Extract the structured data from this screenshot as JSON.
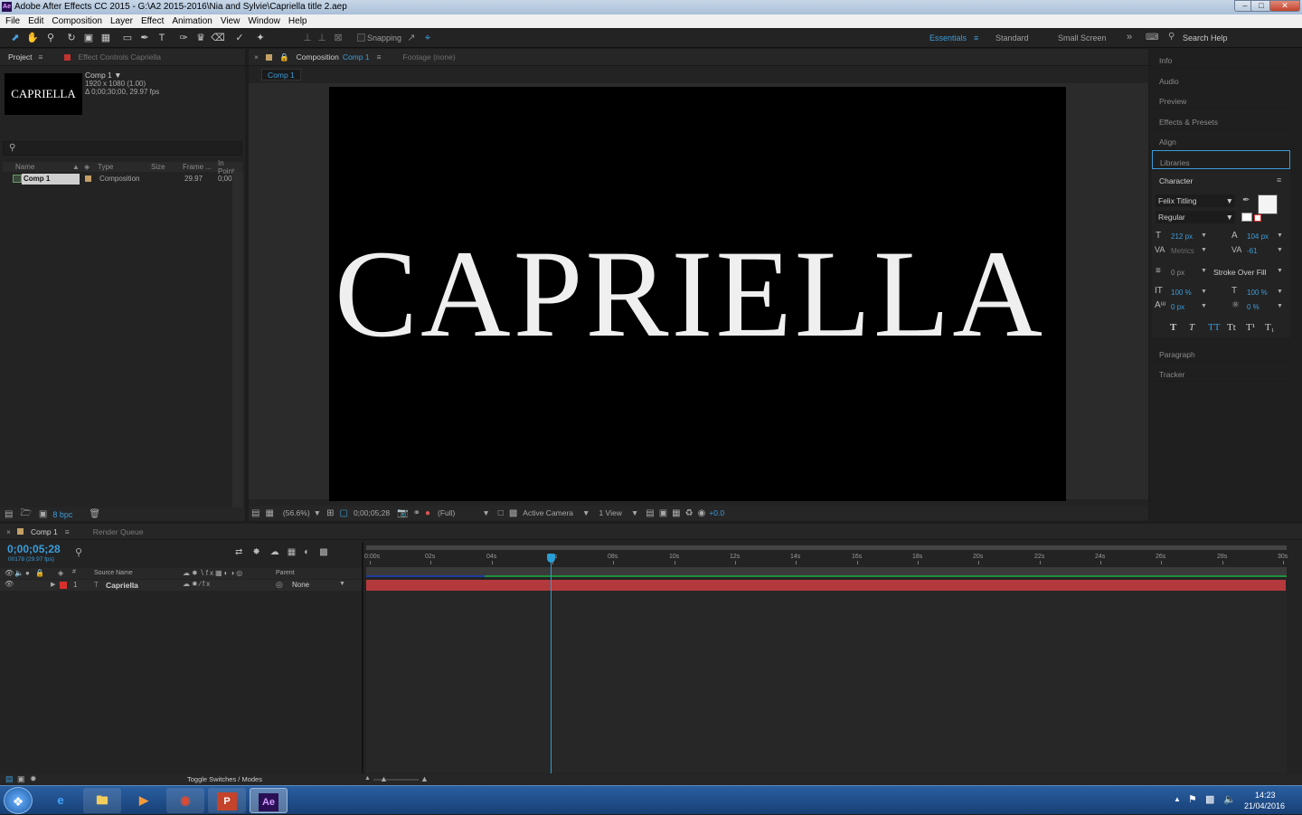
{
  "window": {
    "title": "Adobe After Effects CC 2015 - G:\\A2 2015-2016\\Nia and Sylvie\\Capriella title 2.aep",
    "app_icon": "Ae",
    "controls": [
      "minimize",
      "maximize",
      "close"
    ]
  },
  "menu": [
    "File",
    "Edit",
    "Composition",
    "Layer",
    "Effect",
    "Animation",
    "View",
    "Window",
    "Help"
  ],
  "toolbar": {
    "snapping_label": "Snapping",
    "workspaces": [
      "Essentials",
      "Standard",
      "Small Screen"
    ],
    "active_workspace": "Essentials",
    "search_help": "Search Help"
  },
  "project_panel": {
    "tabs": [
      "Project",
      "Effect Controls Capriella"
    ],
    "thumbnail_text": "CAPRIELLA",
    "item_name": "Comp 1",
    "item_res": "1920 x 1080 (1.00)",
    "item_dur": "Δ 0;00;30;00, 29.97 fps",
    "columns": [
      "Name",
      "Type",
      "Size",
      "Frame ...",
      "In Point"
    ],
    "rows": [
      {
        "name": "Comp 1",
        "type": "Composition",
        "size": "",
        "frame": "29.97",
        "in": "0;00"
      }
    ],
    "bpc": "8 bpc"
  },
  "comp_panel": {
    "tab_label": "Composition",
    "tab_comp": "Comp 1",
    "footage_tab": "Footage (none)",
    "flow_tab": "Comp 1",
    "canvas_text": "CAPRIELLA",
    "zoom": "(56.6%)",
    "timecode": "0;00;05;28",
    "resolution": "(Full)",
    "camera": "Active Camera",
    "views": "1 View",
    "exposure": "+0.0"
  },
  "right_panel": {
    "items_top": [
      "Info",
      "Audio",
      "Preview",
      "Effects & Presets",
      "Align",
      "Libraries"
    ],
    "character": {
      "title": "Character",
      "font": "Felix Titling",
      "style": "Regular",
      "size": "212 px",
      "leading": "104 px",
      "kerning": "Metrics",
      "tracking": "-61",
      "stroke": "0 px",
      "stroke_mode": "Stroke Over Fill",
      "vscale": "100 %",
      "hscale": "100 %",
      "baseline": "0 px",
      "tsume": "0 %",
      "styles": [
        "T",
        "T",
        "TT",
        "Tt",
        "T¹",
        "T₁"
      ]
    },
    "items_bottom": [
      "Paragraph",
      "Tracker"
    ]
  },
  "timeline": {
    "tabs": [
      "Comp 1",
      "Render Queue"
    ],
    "timecode": "0;00;05;28",
    "frame_info": "00178 (29.97 fps)",
    "col_source": "Source Name",
    "col_parent": "Parent",
    "layer_num": "1",
    "layer_name": "Capriella",
    "parent": "None",
    "ruler": [
      "0:00s",
      "02s",
      "04s",
      "06s",
      "08s",
      "10s",
      "12s",
      "14s",
      "16s",
      "18s",
      "20s",
      "22s",
      "24s",
      "26s",
      "28s",
      "30s"
    ],
    "toggle_label": "Toggle Switches / Modes",
    "colors": {
      "layer_bar": "#b4393c",
      "work_area": "#1f8f3a",
      "playhead": "#2a9fd6"
    }
  },
  "taskbar": {
    "apps": [
      "windows-start",
      "internet-explorer",
      "file-explorer",
      "media-player",
      "chrome",
      "powerpoint",
      "after-effects"
    ],
    "time": "14:23",
    "date": "21/04/2016"
  }
}
